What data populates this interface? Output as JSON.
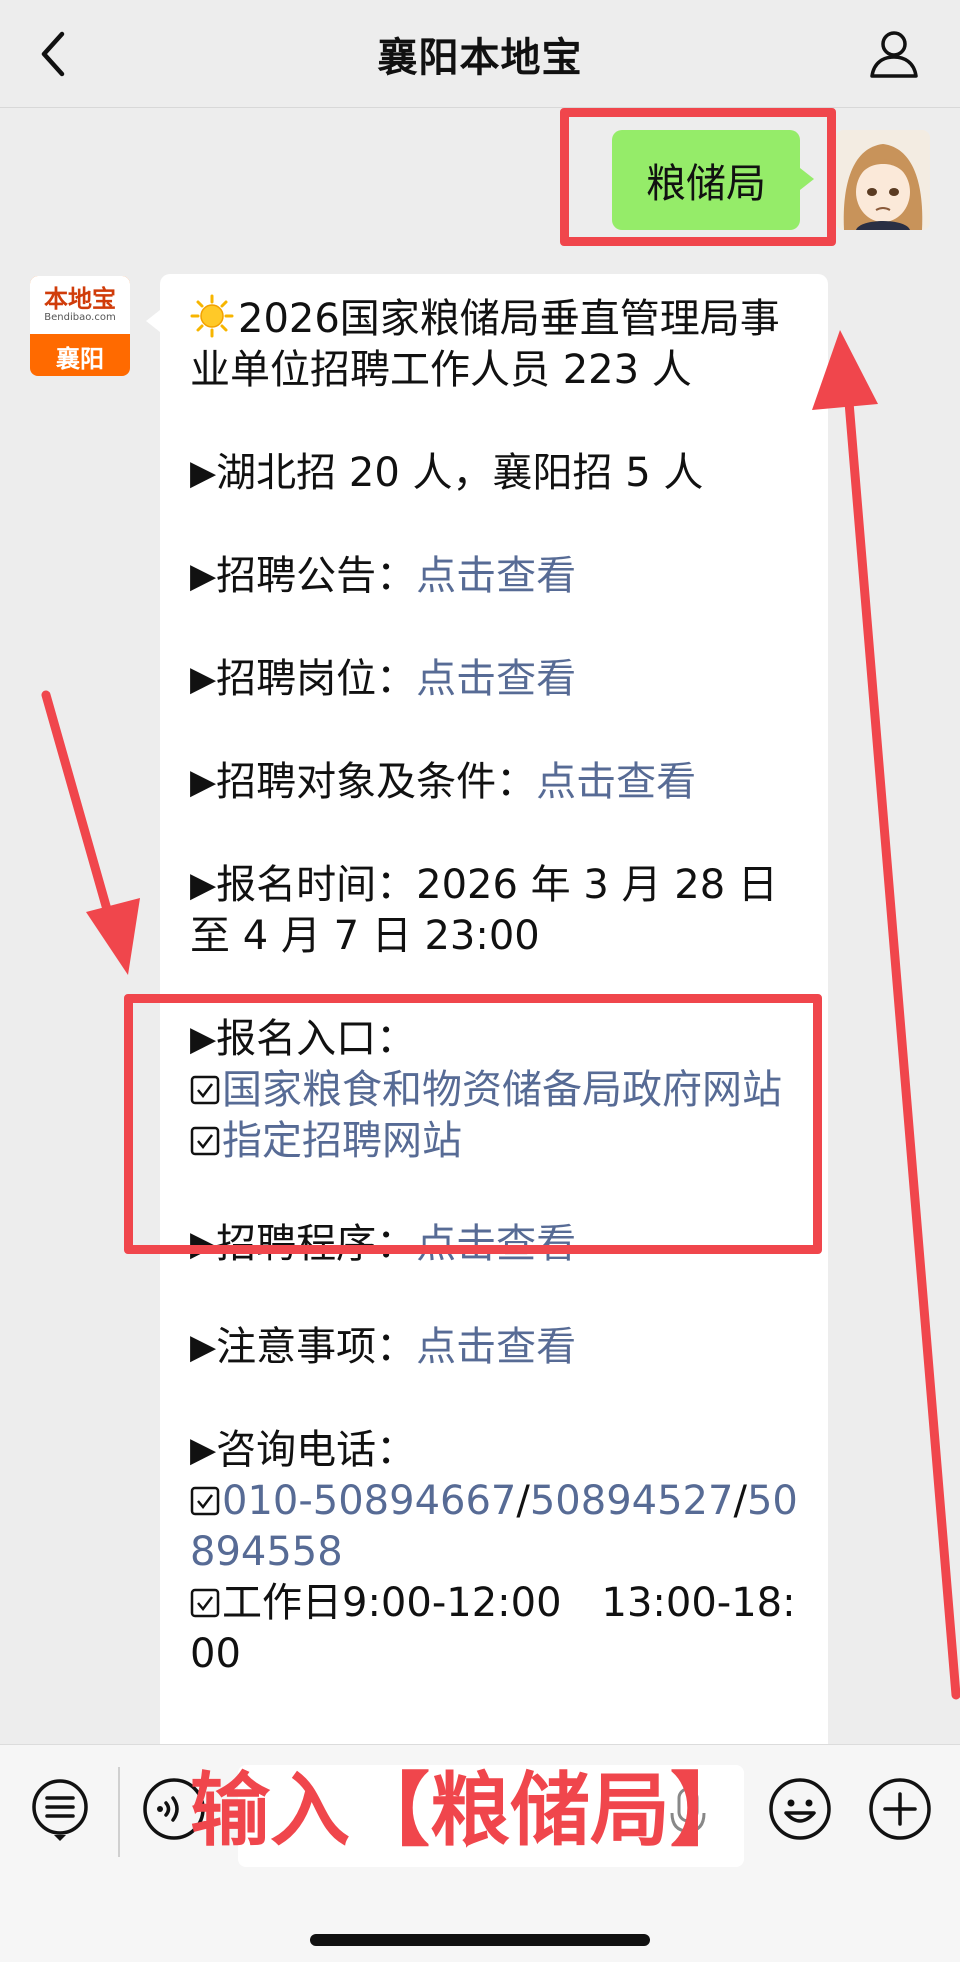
{
  "header": {
    "title": "襄阳本地宝"
  },
  "user_message": {
    "text": "粮储局"
  },
  "bot": {
    "avatar_logo_text": "本地宝",
    "avatar_logo_sub": "Bendibao.com",
    "avatar_city": "襄阳"
  },
  "article": {
    "headline": "2026国家粮储局垂直管理局事业单位招聘工作人员 223 人",
    "quota": "湖北招 20 人，襄阳招 5 人",
    "announcement_label": "招聘公告：",
    "announcement_link": "点击查看",
    "positions_label": "招聘岗位：",
    "positions_link": "点击查看",
    "conditions_label": "招聘对象及条件：",
    "conditions_link": "点击查看",
    "time_label": "报名时间：",
    "time_value": "2026 年 3 月 28 日至 4 月 7 日 23:00",
    "entry_label": "报名入口：",
    "entry_link_1": "国家粮食和物资储备局政府网站",
    "entry_link_2": "指定招聘网站",
    "procedure_label": "招聘程序：",
    "procedure_link": "点击查看",
    "notes_label": "注意事项：",
    "notes_link": "点击查看",
    "phone_label": "咨询电话：",
    "phone_1": "010-50894667",
    "phone_sep_1": "/",
    "phone_2": "50894527",
    "phone_sep_2": "/",
    "phone_3": "50894558",
    "workday": "工作日9:00-12:00　13:00-18:00"
  },
  "input_bar": {
    "overlay_instruction": "输入【粮储局】"
  },
  "colors": {
    "background": "#ededed",
    "my_bubble": "#95ec69",
    "link": "#576b95",
    "annotation_red": "#f0464c",
    "brand_orange": "#ff6a00"
  },
  "icons": [
    "back-chevron-icon",
    "user-profile-icon",
    "sun-icon",
    "checkbox-icon",
    "menu-list-icon",
    "voice-icon",
    "microphone-icon",
    "emoji-icon",
    "plus-icon"
  ]
}
